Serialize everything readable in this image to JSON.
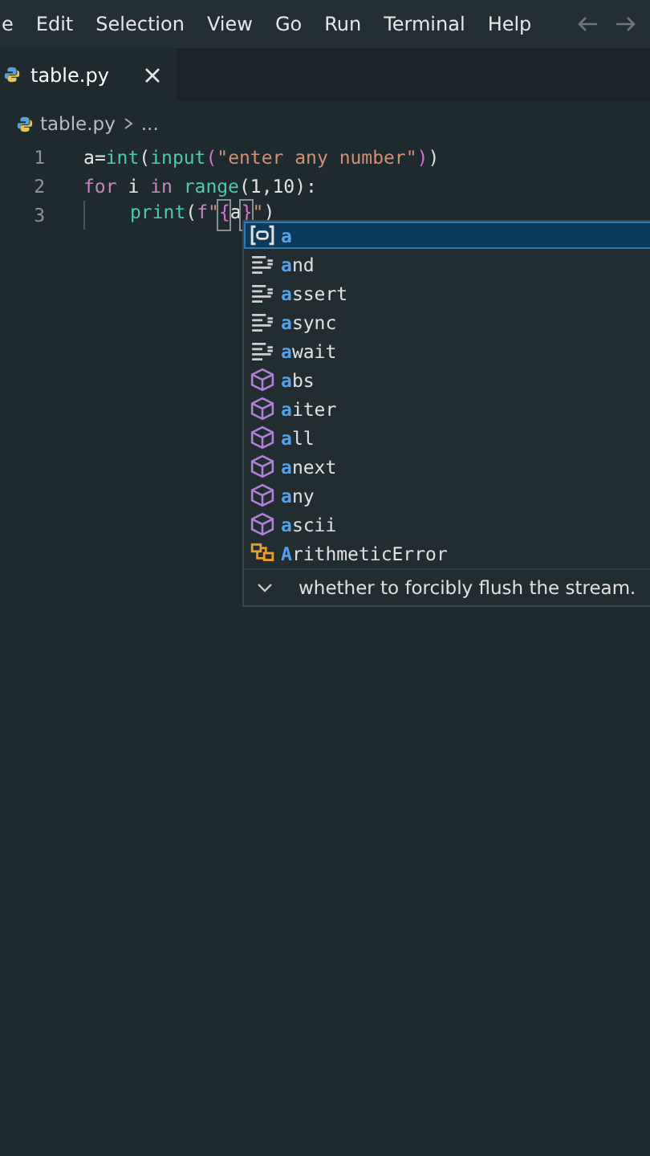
{
  "menu_bar": {
    "items": [
      "e",
      "Edit",
      "Selection",
      "View",
      "Go",
      "Run",
      "Terminal",
      "Help"
    ]
  },
  "tabs": [
    {
      "label": "table.py",
      "selected": true
    }
  ],
  "breadcrumb": {
    "file": "table.py",
    "more": "..."
  },
  "editor": {
    "lines": [
      {
        "number": "1",
        "indent": false,
        "tokens": [
          {
            "kind": "var",
            "text": "a"
          },
          {
            "kind": "plain",
            "text": "="
          },
          {
            "kind": "func",
            "text": "int"
          },
          {
            "kind": "plain",
            "text": "("
          },
          {
            "kind": "func",
            "text": "input"
          },
          {
            "kind": "paren",
            "text": "("
          },
          {
            "kind": "string",
            "text": "\"enter any number\""
          },
          {
            "kind": "paren",
            "text": ")"
          },
          {
            "kind": "plain",
            "text": ")"
          }
        ]
      },
      {
        "number": "2",
        "indent": false,
        "tokens": [
          {
            "kind": "keyword",
            "text": "for "
          },
          {
            "kind": "var",
            "text": "i "
          },
          {
            "kind": "keyword",
            "text": "in "
          },
          {
            "kind": "func",
            "text": "range"
          },
          {
            "kind": "plain",
            "text": "(1,10):"
          }
        ]
      },
      {
        "number": "3",
        "indent": true,
        "tokens": [
          {
            "kind": "func",
            "text": "print"
          },
          {
            "kind": "plain",
            "text": "("
          },
          {
            "kind": "keyword",
            "text": "f"
          },
          {
            "kind": "string",
            "text": "\""
          },
          {
            "kind": "match",
            "text": "{"
          },
          {
            "kind": "var",
            "text": "a"
          },
          {
            "kind": "match",
            "text": "}"
          },
          {
            "kind": "string",
            "text": "\""
          },
          {
            "kind": "plain",
            "text": ")"
          }
        ]
      }
    ]
  },
  "suggestions": {
    "items": [
      {
        "kind": "variable",
        "match": "a",
        "selected": true
      },
      {
        "kind": "keyword",
        "match": "a",
        "rest": "nd",
        "selected": false
      },
      {
        "kind": "keyword",
        "match": "a",
        "rest": "ssert",
        "selected": false
      },
      {
        "kind": "keyword",
        "match": "a",
        "rest": "sync",
        "selected": false
      },
      {
        "kind": "keyword",
        "match": "a",
        "rest": "wait",
        "selected": false
      },
      {
        "kind": "function",
        "match": "a",
        "rest": "bs",
        "selected": false
      },
      {
        "kind": "function",
        "match": "a",
        "rest": "iter",
        "selected": false
      },
      {
        "kind": "function",
        "match": "a",
        "rest": "ll",
        "selected": false
      },
      {
        "kind": "function",
        "match": "a",
        "rest": "next",
        "selected": false
      },
      {
        "kind": "function",
        "match": "a",
        "rest": "ny",
        "selected": false
      },
      {
        "kind": "function",
        "match": "a",
        "rest": "scii",
        "selected": false
      },
      {
        "kind": "class",
        "match": "A",
        "rest": "rithmeticError",
        "selected": false
      }
    ],
    "details": "whether to forcibly flush the stream."
  }
}
